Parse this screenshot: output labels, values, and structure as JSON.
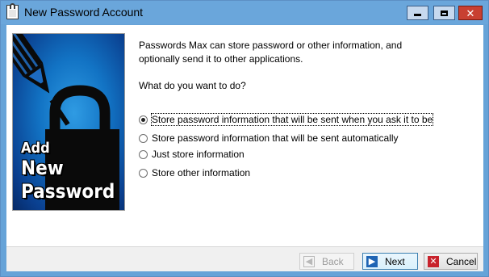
{
  "window": {
    "title": "New Password Account",
    "controls": {
      "minimize": "minimize",
      "maximize": "maximize",
      "close": "✕"
    }
  },
  "banner": {
    "line1": "Add",
    "line2": "New",
    "line3": "Password"
  },
  "intro": {
    "line1": "Passwords Max can store password or other information, and",
    "line2": "optionally send it to other applications."
  },
  "question": "What do you want to do?",
  "options": [
    {
      "label": "Store password information that will be sent when you ask it to be",
      "selected": true
    },
    {
      "label": "Store password information that will be sent automatically",
      "selected": false
    },
    {
      "label": "Just store information",
      "selected": false
    },
    {
      "label": "Store other information",
      "selected": false
    }
  ],
  "buttons": {
    "back": "Back",
    "next": "Next",
    "cancel": "Cancel"
  },
  "colors": {
    "titlebar": "#6aa6db",
    "close_button": "#c84031",
    "banner_blue": "#1273c4"
  }
}
